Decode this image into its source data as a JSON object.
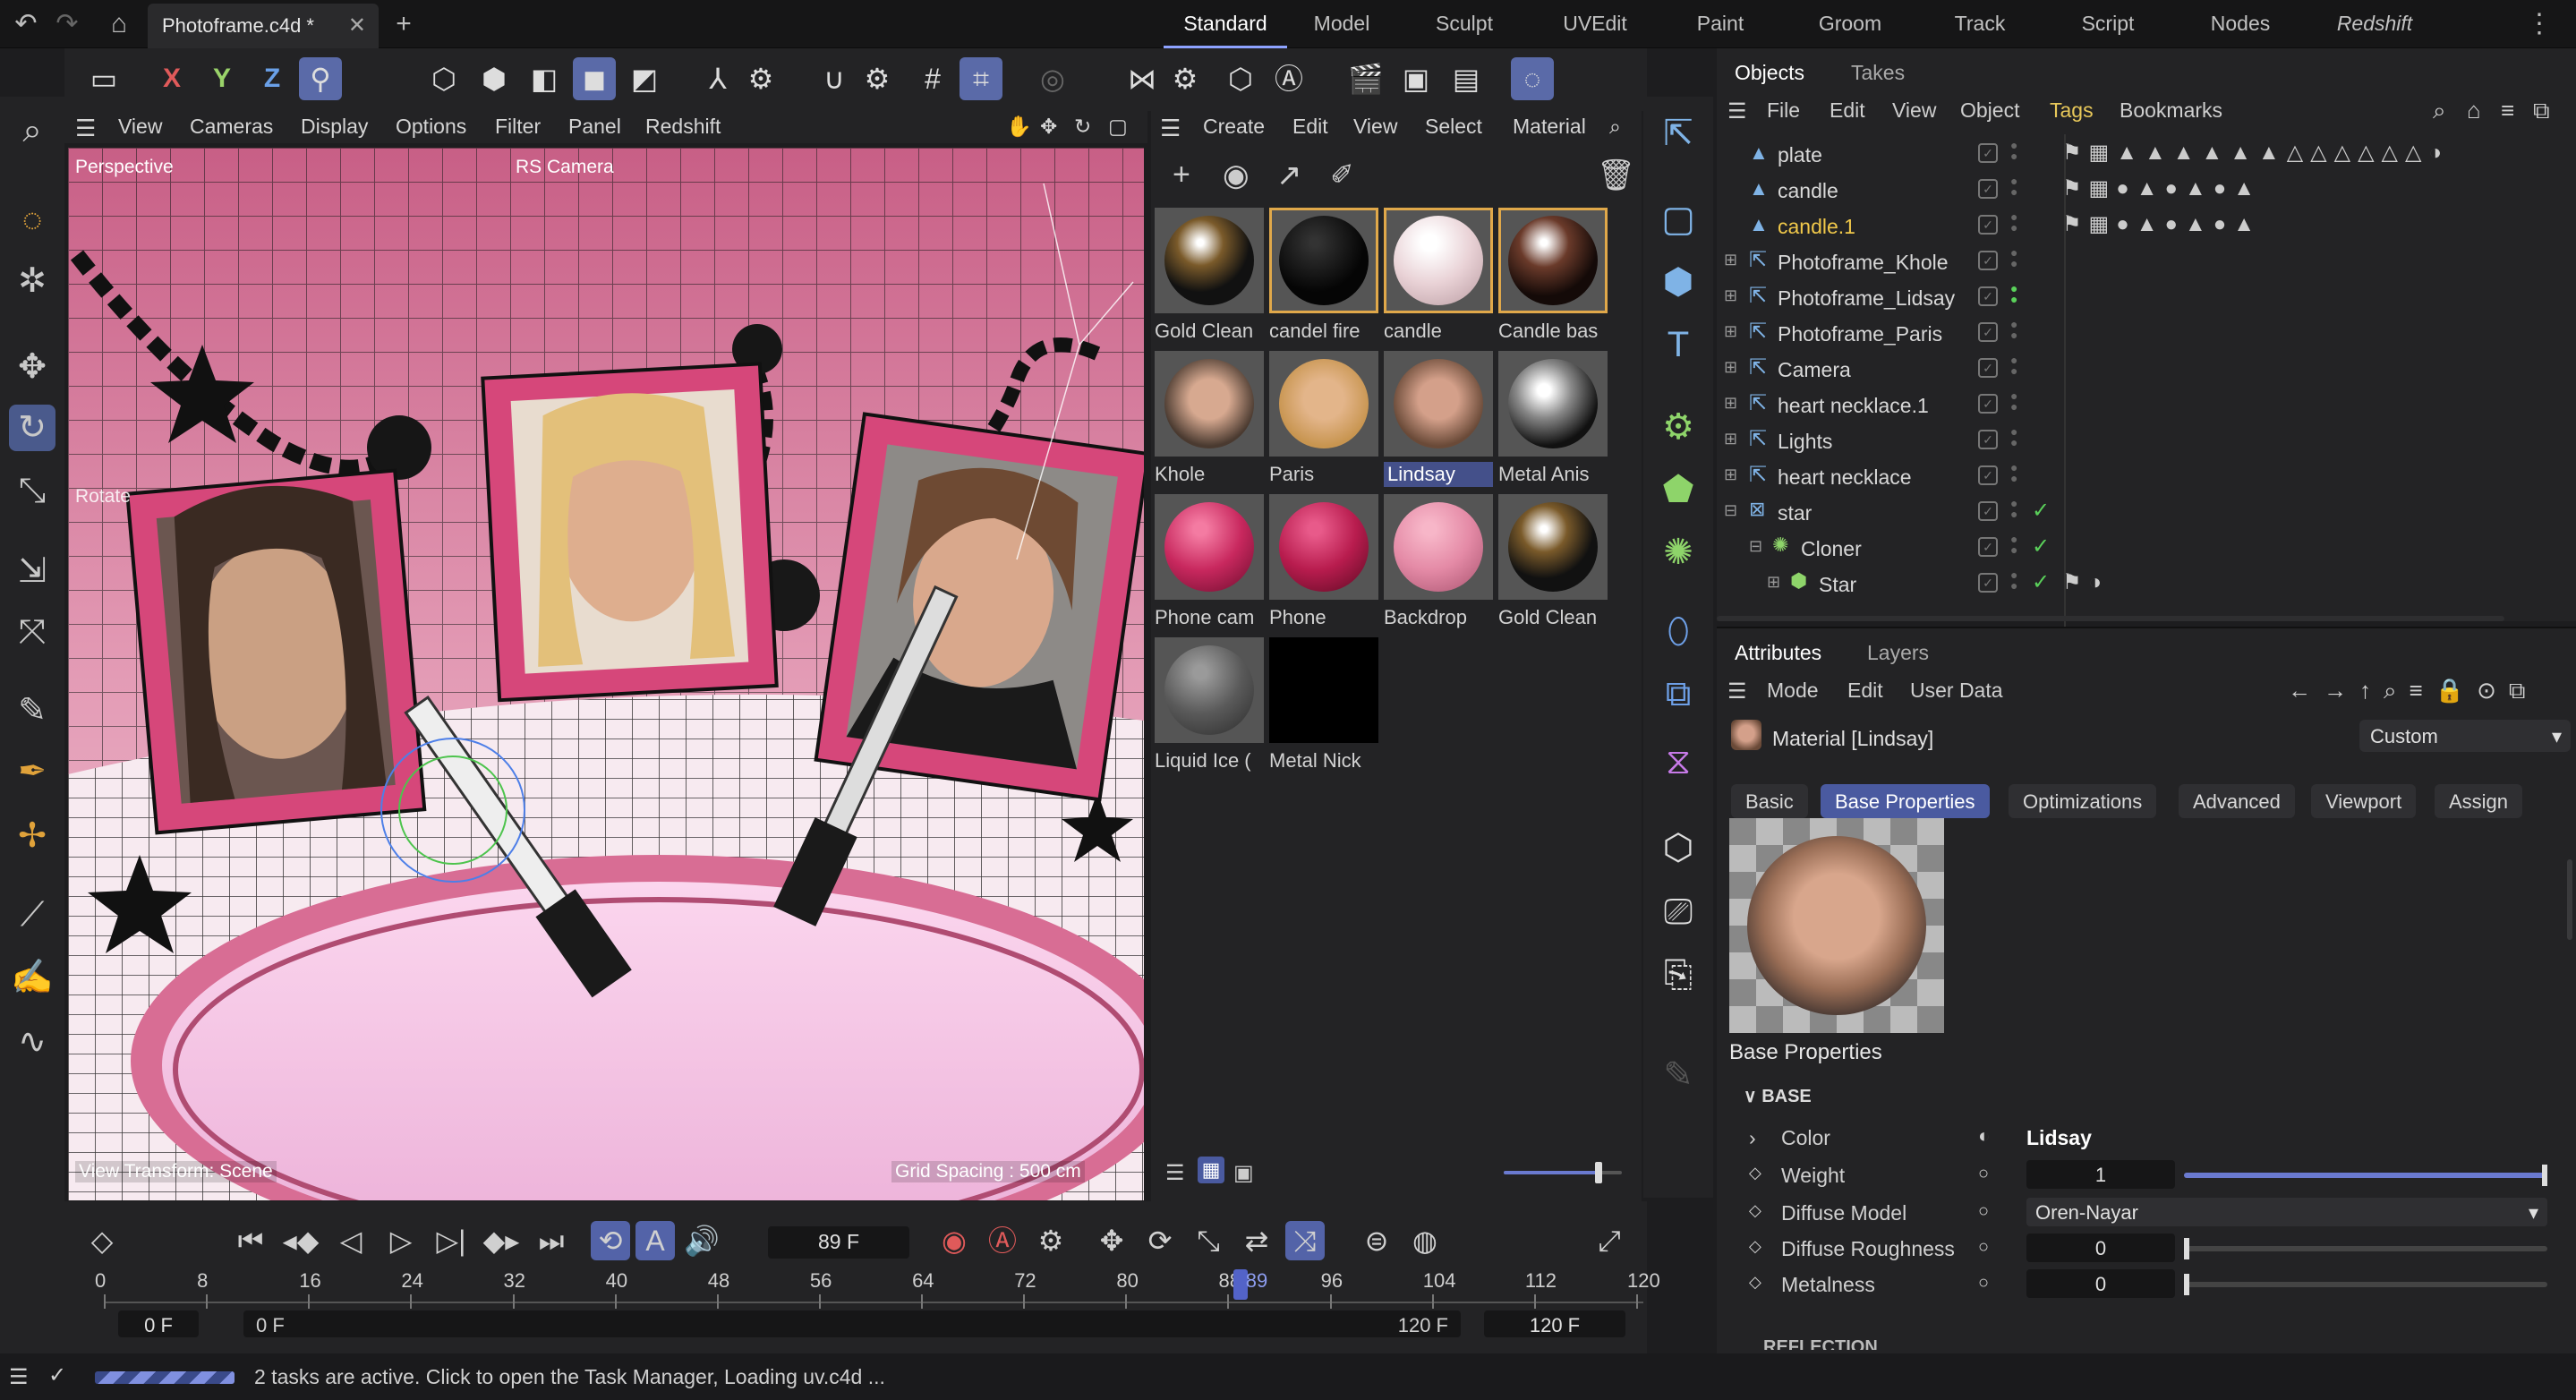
{
  "document": {
    "tab_title": "Photoframe.c4d *"
  },
  "layouts": [
    "Standard",
    "Model",
    "Sculpt",
    "UVEdit",
    "Paint",
    "Groom",
    "Track",
    "Script",
    "Nodes",
    "Redshift"
  ],
  "active_layout": "Standard",
  "toolbar": {
    "x": "X",
    "y": "Y",
    "z": "Z"
  },
  "viewport": {
    "menu": [
      "View",
      "Cameras",
      "Display",
      "Options",
      "Filter",
      "Panel",
      "Redshift"
    ],
    "label": "Perspective",
    "camera": "RS Camera",
    "tool_label": "Rotate",
    "transform_label": "View Transform: Scene",
    "grid_label": "Grid Spacing : 500 cm"
  },
  "material_manager": {
    "menu": [
      "Create",
      "Edit",
      "View",
      "Select",
      "Material"
    ],
    "materials": [
      {
        "name": "Gold Clean",
        "selected": false
      },
      {
        "name": "candel fire",
        "selected": true
      },
      {
        "name": "candle",
        "selected": true
      },
      {
        "name": "Candle bas",
        "selected": true
      },
      {
        "name": "Khole",
        "selected": false
      },
      {
        "name": "Paris",
        "selected": false
      },
      {
        "name": "Lindsay",
        "selected": false,
        "active": true
      },
      {
        "name": "Metal Anis",
        "selected": false
      },
      {
        "name": "Phone cam",
        "selected": false
      },
      {
        "name": "Phone",
        "selected": false
      },
      {
        "name": "Backdrop",
        "selected": false
      },
      {
        "name": "Gold Clean",
        "selected": false
      },
      {
        "name": "Liquid Ice (",
        "selected": false
      },
      {
        "name": "Metal Nick",
        "selected": false
      }
    ],
    "slider_value": 0.8
  },
  "objects_panel": {
    "tabs": [
      "Objects",
      "Takes"
    ],
    "menu": [
      "File",
      "Edit",
      "View",
      "Object",
      "Tags",
      "Bookmarks"
    ],
    "rows": [
      {
        "name": "plate",
        "highlight": false
      },
      {
        "name": "candle",
        "highlight": false
      },
      {
        "name": "candle.1",
        "highlight": true
      },
      {
        "name": "Photoframe_Khole",
        "highlight": false
      },
      {
        "name": "Photoframe_Lidsay",
        "highlight": false
      },
      {
        "name": "Photoframe_Paris",
        "highlight": false
      },
      {
        "name": "Camera",
        "highlight": false
      },
      {
        "name": "heart necklace.1",
        "highlight": false
      },
      {
        "name": "Lights",
        "highlight": false
      },
      {
        "name": "heart necklace",
        "highlight": false
      },
      {
        "name": "star",
        "highlight": false
      },
      {
        "name": "Cloner",
        "highlight": false
      },
      {
        "name": "Star",
        "highlight": false
      }
    ]
  },
  "attributes": {
    "tabs": [
      "Attributes",
      "Layers"
    ],
    "menu": [
      "Mode",
      "Edit",
      "User Data"
    ],
    "title": "Material [Lindsay]",
    "preset": "Custom",
    "subtabs": [
      "Basic",
      "Base Properties",
      "Optimizations",
      "Advanced",
      "Viewport",
      "Assign"
    ],
    "active_subtab": "Base Properties",
    "section_title": "Base Properties",
    "group": "BASE",
    "next_group": "REFLECTION",
    "props": {
      "color_label": "Color",
      "color_value": "Lidsay",
      "weight_label": "Weight",
      "weight_value": "1",
      "diffuse_model_label": "Diffuse Model",
      "diffuse_model_value": "Oren-Nayar",
      "diffuse_roughness_label": "Diffuse Roughness",
      "diffuse_roughness_value": "0",
      "metalness_label": "Metalness",
      "metalness_value": "0"
    },
    "weight_fraction": 1.0
  },
  "timeline": {
    "current_frame": "89 F",
    "ticks": [
      "0",
      "8",
      "16",
      "24",
      "32",
      "40",
      "48",
      "56",
      "64",
      "72",
      "80",
      "88",
      "96",
      "104",
      "112",
      "120"
    ],
    "playhead_label": "89",
    "start": "0 F",
    "min": "0 F",
    "max": "120 F",
    "end": "120 F"
  },
  "status": {
    "text": "2 tasks are active. Click to open the Task Manager, Loading uv.c4d ..."
  }
}
